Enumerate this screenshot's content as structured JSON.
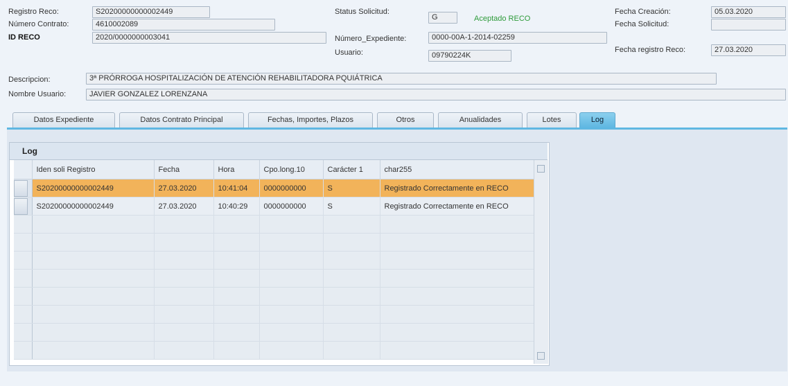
{
  "header": {
    "registro_reco_label": "Registro Reco:",
    "registro_reco_value": "S20200000000002449",
    "numero_contrato_label": "Número Contrato:",
    "numero_contrato_value": "4610002089",
    "id_reco_label": "ID RECO",
    "id_reco_value": "2020/0000000003041",
    "status_label": "Status Solicitud:",
    "status_value": "G",
    "status_text": "Aceptado RECO",
    "numero_expediente_label": "Número_Expediente:",
    "numero_expediente_value": "0000-00A-1-2014-02259",
    "usuario_label": "Usuario:",
    "usuario_value": "09790224K",
    "fecha_creacion_label": "Fecha Creación:",
    "fecha_creacion_value": "05.03.2020",
    "fecha_solicitud_label": "Fecha Solicitud:",
    "fecha_solicitud_value": "",
    "fecha_registro_label": "Fecha registro Reco:",
    "fecha_registro_value": "27.03.2020",
    "descripcion_label": "Descripcion:",
    "descripcion_value": "3ª PRÓRROGA HOSPITALIZACIÓN DE ATENCIÓN REHABILITADORA PQUIÁTRICA",
    "nombre_usuario_label": "Nombre Usuario:",
    "nombre_usuario_value": "JAVIER GONZALEZ LORENZANA"
  },
  "tabs": [
    {
      "label": "Datos Expediente"
    },
    {
      "label": "Datos Contrato Principal"
    },
    {
      "label": "Fechas, Importes, Plazos"
    },
    {
      "label": "Otros"
    },
    {
      "label": "Anualidades"
    },
    {
      "label": "Lotes"
    },
    {
      "label": "Log"
    }
  ],
  "active_tab": "Log",
  "log": {
    "title": "Log",
    "columns": [
      "Iden soli Registro",
      "Fecha",
      "Hora",
      "Cpo.long.10",
      "Carácter 1",
      "char255"
    ],
    "rows": [
      [
        "S20200000000002449",
        "27.03.2020",
        "10:41:04",
        "0000000000",
        "S",
        "Registrado Correctamente en RECO"
      ],
      [
        "S20200000000002449",
        "27.03.2020",
        "10:40:29",
        "0000000000",
        "S",
        "Registrado Correctamente en RECO"
      ]
    ],
    "highlighted_row": 0
  },
  "colors": {
    "accent": "#5fb7e2",
    "highlight_row": "#f2b35a",
    "status_green": "#2e9b3a"
  }
}
